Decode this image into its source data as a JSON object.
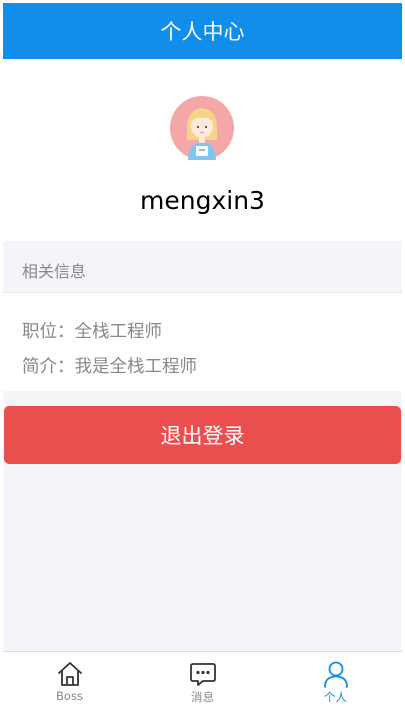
{
  "header": {
    "title": "个人中心"
  },
  "profile": {
    "username": "mengxin3",
    "avatar_icon": "avatar-icon"
  },
  "section": {
    "title": "相关信息"
  },
  "info": {
    "position_line": "职位：全栈工程师",
    "intro_line": "简介：我是全栈工程师"
  },
  "logout": {
    "label": "退出登录"
  },
  "tabs": [
    {
      "label": "Boss",
      "icon": "home-icon",
      "active": false
    },
    {
      "label": "消息",
      "icon": "message-icon",
      "active": false
    },
    {
      "label": "个人",
      "icon": "user-icon",
      "active": true
    }
  ],
  "colors": {
    "primary": "#108ee9",
    "danger": "#e94f4f",
    "muted_text": "#888888",
    "background": "#f5f5f9"
  }
}
